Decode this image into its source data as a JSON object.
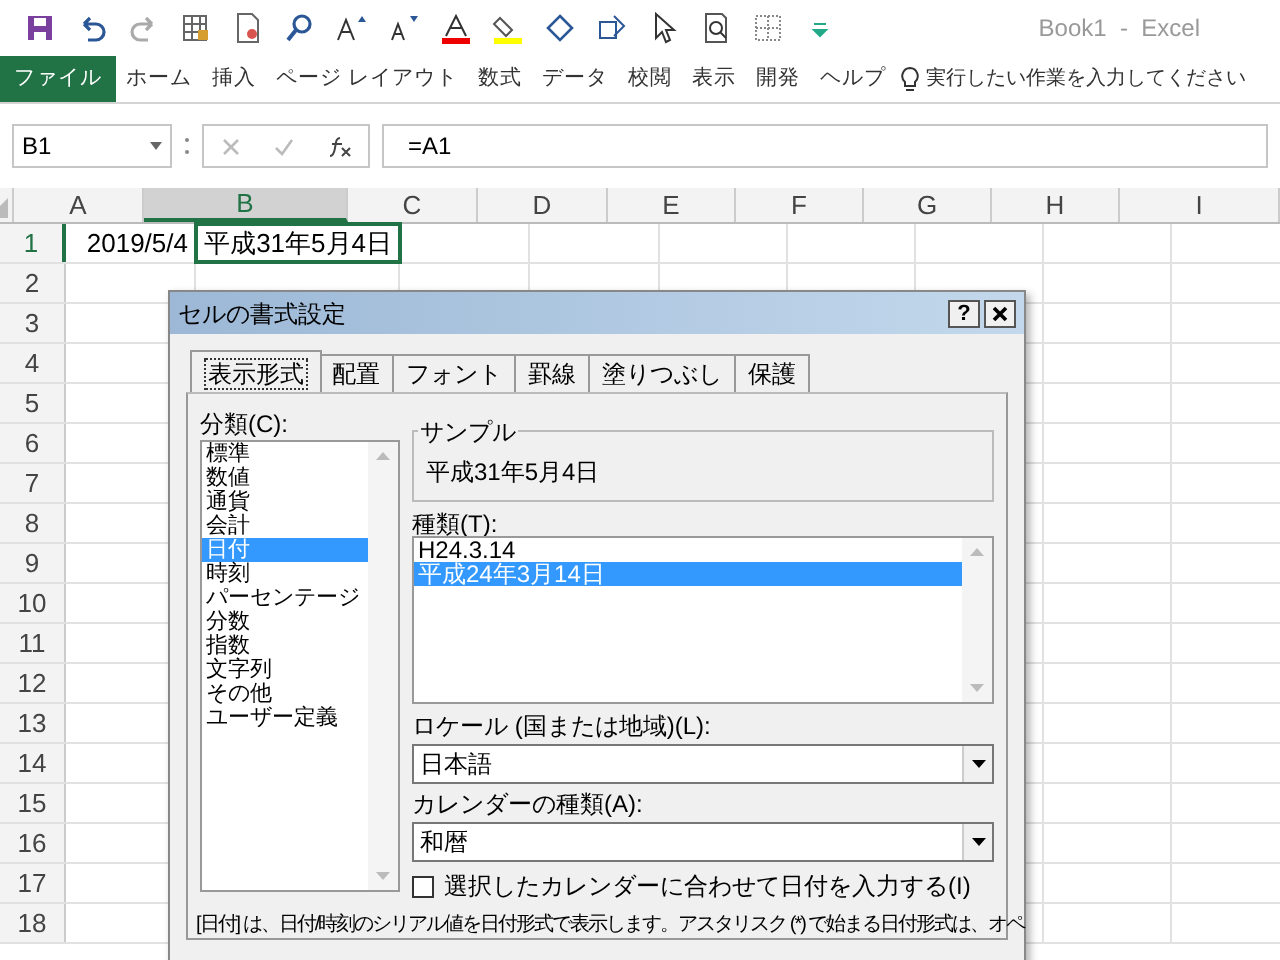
{
  "window": {
    "title": "Book1  -  Excel"
  },
  "ribbon_tabs": [
    {
      "label": "ファイル",
      "kind": "file",
      "selected": false
    },
    {
      "label": "ホーム",
      "kind": "tab",
      "selected": false
    },
    {
      "label": "挿入",
      "kind": "tab",
      "selected": false
    },
    {
      "label": "ページ レイアウト",
      "kind": "tab",
      "selected": false
    },
    {
      "label": "数式",
      "kind": "tab",
      "selected": false
    },
    {
      "label": "データ",
      "kind": "tab",
      "selected": false
    },
    {
      "label": "校閲",
      "kind": "tab",
      "selected": false
    },
    {
      "label": "表示",
      "kind": "tab",
      "selected": false
    },
    {
      "label": "開発",
      "kind": "tab",
      "selected": false
    },
    {
      "label": "ヘルプ",
      "kind": "tab",
      "selected": false
    }
  ],
  "tell_me": "実行したい作業を入力してください",
  "formula_bar": {
    "name_box": "B1",
    "formula": "=A1"
  },
  "columns": [
    {
      "label": "A",
      "selected": false
    },
    {
      "label": "B",
      "selected": true
    },
    {
      "label": "C",
      "selected": false
    },
    {
      "label": "D",
      "selected": false
    },
    {
      "label": "E",
      "selected": false
    },
    {
      "label": "F",
      "selected": false
    },
    {
      "label": "G",
      "selected": false
    },
    {
      "label": "H",
      "selected": false
    },
    {
      "label": "I",
      "selected": false
    }
  ],
  "rows": [
    {
      "label": "1",
      "selected": true,
      "cells": [
        "2019/5/4",
        "平成31年5月4日"
      ]
    },
    {
      "label": "2",
      "selected": false
    },
    {
      "label": "3",
      "selected": false
    },
    {
      "label": "4",
      "selected": false
    },
    {
      "label": "5",
      "selected": false
    },
    {
      "label": "6",
      "selected": false
    },
    {
      "label": "7",
      "selected": false
    },
    {
      "label": "8",
      "selected": false
    },
    {
      "label": "9",
      "selected": false
    },
    {
      "label": "10",
      "selected": false
    },
    {
      "label": "11",
      "selected": false
    },
    {
      "label": "12",
      "selected": false
    },
    {
      "label": "13",
      "selected": false
    },
    {
      "label": "14",
      "selected": false
    },
    {
      "label": "15",
      "selected": false
    },
    {
      "label": "16",
      "selected": false
    },
    {
      "label": "17",
      "selected": false
    },
    {
      "label": "18",
      "selected": false
    }
  ],
  "dialog": {
    "title": "セルの書式設定",
    "help": "?",
    "tabs": [
      {
        "label": "表示形式",
        "selected": true
      },
      {
        "label": "配置",
        "selected": false
      },
      {
        "label": "フォント",
        "selected": false
      },
      {
        "label": "罫線",
        "selected": false
      },
      {
        "label": "塗りつぶし",
        "selected": false
      },
      {
        "label": "保護",
        "selected": false
      }
    ],
    "category_label": "分類(C):",
    "categories": [
      {
        "label": "標準",
        "selected": false
      },
      {
        "label": "数値",
        "selected": false
      },
      {
        "label": "通貨",
        "selected": false
      },
      {
        "label": "会計",
        "selected": false
      },
      {
        "label": "日付",
        "selected": true
      },
      {
        "label": "時刻",
        "selected": false
      },
      {
        "label": "パーセンテージ",
        "selected": false
      },
      {
        "label": "分数",
        "selected": false
      },
      {
        "label": "指数",
        "selected": false
      },
      {
        "label": "文字列",
        "selected": false
      },
      {
        "label": "その他",
        "selected": false
      },
      {
        "label": "ユーザー定義",
        "selected": false
      }
    ],
    "sample": {
      "label": "サンプル",
      "value": "平成31年5月4日"
    },
    "type_label": "種類(T):",
    "types": [
      {
        "label": "H24.3.14",
        "selected": false
      },
      {
        "label": "平成24年3月14日",
        "selected": true
      }
    ],
    "locale_label": "ロケール (国または地域)(L):",
    "locale": "日本語",
    "calendar_label": "カレンダーの種類(A):",
    "calendar": "和暦",
    "checkbox": {
      "label": "選択したカレンダーに合わせて日付を入力する(I)",
      "checked": false
    },
    "description": "[日付] は、日付/時刻のシリアル値を日付形式で表示します。アスタリスク (*) で始まる日付形式は、オペ"
  }
}
